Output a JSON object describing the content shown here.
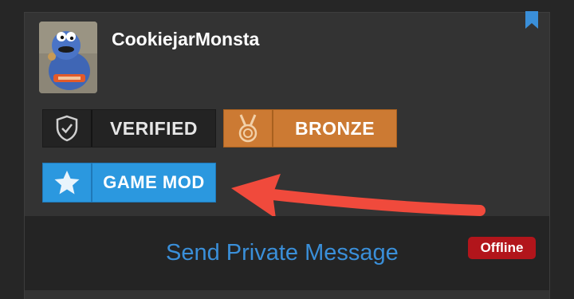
{
  "profile": {
    "username": "CookiejarMonsta",
    "avatar_icon": "cookie-monster-avatar"
  },
  "badges": [
    {
      "label": "VERIFIED",
      "icon": "shield-check-icon",
      "color": "#232323"
    },
    {
      "label": "BRONZE",
      "icon": "medal-icon",
      "color": "#cc7a33"
    },
    {
      "label": "GAME MOD",
      "icon": "star-icon",
      "color": "#2b98df"
    }
  ],
  "annotation": {
    "type": "arrow",
    "color": "#f04a3c",
    "points_to": "GAME MOD"
  },
  "footer": {
    "send_message_label": "Send Private Message",
    "status_label": "Offline",
    "status_color": "#b2151b"
  },
  "colors": {
    "link": "#3a8fd9",
    "bookmark": "#3a8fd9"
  }
}
